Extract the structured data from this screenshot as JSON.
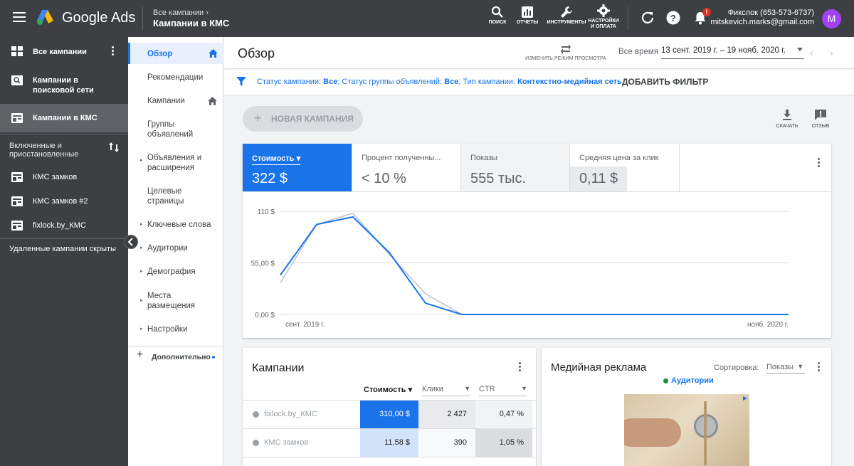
{
  "app": {
    "brand": "Google Ads"
  },
  "breadcrumb": {
    "parent": "Все кампании",
    "current": "Кампании в КМС"
  },
  "tools": {
    "search": "ПОИСК",
    "reports": "ОТЧЕТЫ",
    "tools": "ИНСТРУМЕНТЫ",
    "settings_line1": "НАСТРОЙКИ",
    "settings_line2": "И ОПЛАТА"
  },
  "notifications": {
    "badge": "!"
  },
  "account": {
    "name": "Фикслок (653-573-6737)",
    "email": "mitskevich.marks@gmail.com",
    "avatar_letter": "M"
  },
  "sidebar": {
    "all_campaigns": "Все кампании",
    "search_campaigns": "Кампании в поисковой сети",
    "display_campaigns": "Кампании в КМС",
    "section_label": "Включенные и приостановленные",
    "campaigns": [
      {
        "label": "КМС замков"
      },
      {
        "label": "КМС замков #2"
      },
      {
        "label": "fixlock.by_КМС"
      }
    ],
    "removed_hidden": "Удаленные кампании скрыты"
  },
  "nav2": {
    "items": [
      {
        "label": "Обзор"
      },
      {
        "label": "Рекомендации"
      },
      {
        "label": "Кампании"
      },
      {
        "label": "Группы объявлений"
      },
      {
        "label": "Объявления и расширения"
      },
      {
        "label": "Целевые страницы"
      },
      {
        "label": "Ключевые слова"
      },
      {
        "label": "Аудитории"
      },
      {
        "label": "Демография"
      },
      {
        "label": "Места размещения"
      },
      {
        "label": "Настройки"
      }
    ],
    "more": "Дополнительно"
  },
  "header": {
    "title": "Обзор",
    "view_mode": "ИЗМЕНИТЬ РЕЖИМ ПРОСМОТРА",
    "range_label": "Все время",
    "range_value": "13 сент. 2019 г. – 19 нояб. 2020 г."
  },
  "filter": {
    "p1": "Статус кампании: ",
    "v1": "Все",
    "p2": "; Статус группы объявлений: ",
    "v2": "Все",
    "p3": "; Тип кампании: ",
    "v3": "Контекстно-медийная сеть",
    "add": "ДОБАВИТЬ ФИЛЬТР"
  },
  "toolbar": {
    "new_campaign": "НОВАЯ КАМПАНИЯ",
    "download": "СКАЧАТЬ",
    "feedback": "ОТЗЫВ"
  },
  "metrics": [
    {
      "name": "Стоимость",
      "value": "322 $"
    },
    {
      "name": "Процент полученны...",
      "value": "< 10 %"
    },
    {
      "name": "Показы",
      "value": "555 тыс."
    },
    {
      "name": "Средняя цена за клик",
      "value": "0,11 $"
    }
  ],
  "chart_data": {
    "type": "line",
    "x": [
      "сент. 2019 г.",
      "p2",
      "p3",
      "p4",
      "p5",
      "p6",
      "p7",
      "p8",
      "p9",
      "p10",
      "p11",
      "p12",
      "p13",
      "p14",
      "нояб. 2020 г."
    ],
    "series": [
      {
        "values": [
          42,
          96,
          104,
          66,
          12,
          0,
          0,
          0,
          0,
          0,
          0,
          0,
          0,
          0,
          0
        ],
        "color": "#1a73e8"
      },
      {
        "values": [
          34,
          96,
          108,
          64,
          22,
          0,
          0,
          0,
          0,
          0,
          0,
          0,
          0,
          0,
          0
        ],
        "color": "#bdc1c6"
      }
    ],
    "yticks": [
      "110 $",
      "55,00 $",
      "0,00 $"
    ],
    "xticks": [
      "сент. 2019 г.",
      "нояб. 2020 г."
    ],
    "ylim": [
      0,
      110
    ],
    "grid": true
  },
  "campaigns_table": {
    "title": "Кампании",
    "headers": {
      "cost": "Стоимость",
      "clicks": "Клики",
      "ctr": "CTR"
    },
    "rows": [
      {
        "name": "fixlock.by_КМС",
        "cost": "310,00 $",
        "clicks": "2 427",
        "ctr": "0,47 %"
      },
      {
        "name": "КМС замков",
        "cost": "11,58 $",
        "clicks": "390",
        "ctr": "1,05 %"
      }
    ]
  },
  "media": {
    "title": "Медийная реклама",
    "sort_label": "Сортировка:",
    "sort_value": "Показы",
    "audience": "Аудитории"
  }
}
